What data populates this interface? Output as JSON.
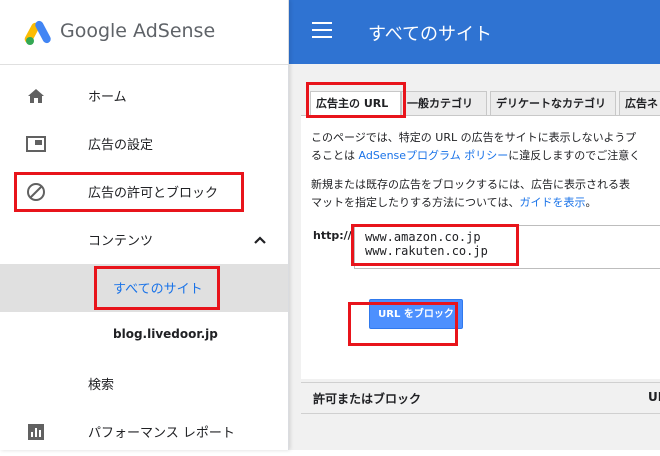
{
  "brand": {
    "name": "Google AdSense"
  },
  "header": {
    "title": "すべてのサイト"
  },
  "sidebar": {
    "items": [
      {
        "label": "ホーム",
        "icon": "home-icon"
      },
      {
        "label": "広告の設定",
        "icon": "ad-settings-icon"
      },
      {
        "label": "広告の許可とブロック",
        "icon": "block-icon"
      },
      {
        "label": "コンテンツ",
        "icon": "chevron-up-icon"
      },
      {
        "label": "すべてのサイト"
      },
      {
        "label": "blog.livedoor.jp"
      },
      {
        "label": "検索"
      },
      {
        "label": "パフォーマンス レポート",
        "icon": "bar-chart-icon"
      }
    ]
  },
  "tabs": [
    {
      "label": "広告主の URL"
    },
    {
      "label": "一般カテゴリ"
    },
    {
      "label": "デリケートなカテゴリ"
    },
    {
      "label": "広告ネ"
    }
  ],
  "content": {
    "para1_line1": "このページでは、特定の URL の広告をサイトに表示しないようプ",
    "para1_line2_pre": "ることは ",
    "para1_link": "AdSenseプログラム ポリシー",
    "para1_line2_post": "に違反しますのでご注意く",
    "para2_line1": "新規または既存の広告をブロックするには、広告に表示される表",
    "para2_line2_pre": "マットを指定したりする方法については、",
    "para2_link": "ガイドを表示",
    "para2_line2_post": "。",
    "http_label": "http://",
    "url_lines": "www.amazon.co.jp\nwww.rakuten.co.jp",
    "block_button": "URL をブロック"
  },
  "table": {
    "col1": "許可またはブロック",
    "col2": "UI"
  },
  "colors": {
    "topbar": "#2f73d2",
    "accent": "#1a73e8",
    "highlight": "#e8141b",
    "button": "#4d90fe"
  }
}
